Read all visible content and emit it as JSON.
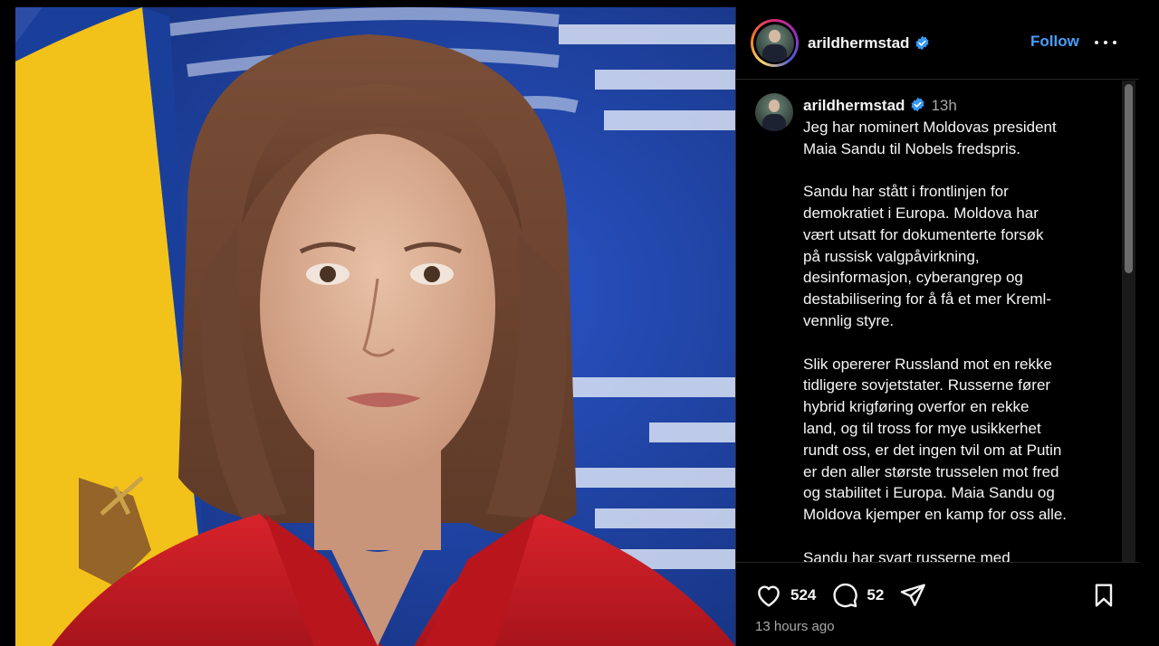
{
  "post": {
    "username": "arildhermstad",
    "follow_label": "Follow",
    "caption_username": "arildhermstad",
    "caption_time": "13h",
    "caption_text": "Jeg har nominert Moldovas president\nMaia Sandu til Nobels fredspris.\n\nSandu har stått i frontlinjen for\ndemokratiet i Europa. Moldova har\nvært utsatt for dokumenterte forsøk\npå russisk valgpåvirkning,\ndesinformasjon, cyberangrep og\ndestabilisering for å få et mer Kreml-\nvennlig styre.\n\nSlik opererer Russland mot en rekke\ntidligere sovjetstater. Russerne fører\nhybrid krigføring overfor en rekke\nland, og til tross for mye usikkerhet\nrundt oss, er det ingen tvil om at Putin\ner den aller største trusselen mot fred\nog stabilitet i Europa. Maia Sandu og\nMoldova kjemper en kamp for oss alle.\n\nSandu har svart russerne med",
    "likes": "524",
    "comments": "52",
    "timestamp": "13 hours ago"
  },
  "icons": {
    "verified": "verified-badge-icon",
    "more": "more-options-icon",
    "like": "heart-icon",
    "comment": "comment-icon",
    "share": "share-icon",
    "save": "bookmark-icon"
  },
  "colors": {
    "background": "#000000",
    "accent": "#4a9dfb",
    "text": "#f5f5f5",
    "muted": "#a8a8a8",
    "divider": "#262626"
  }
}
